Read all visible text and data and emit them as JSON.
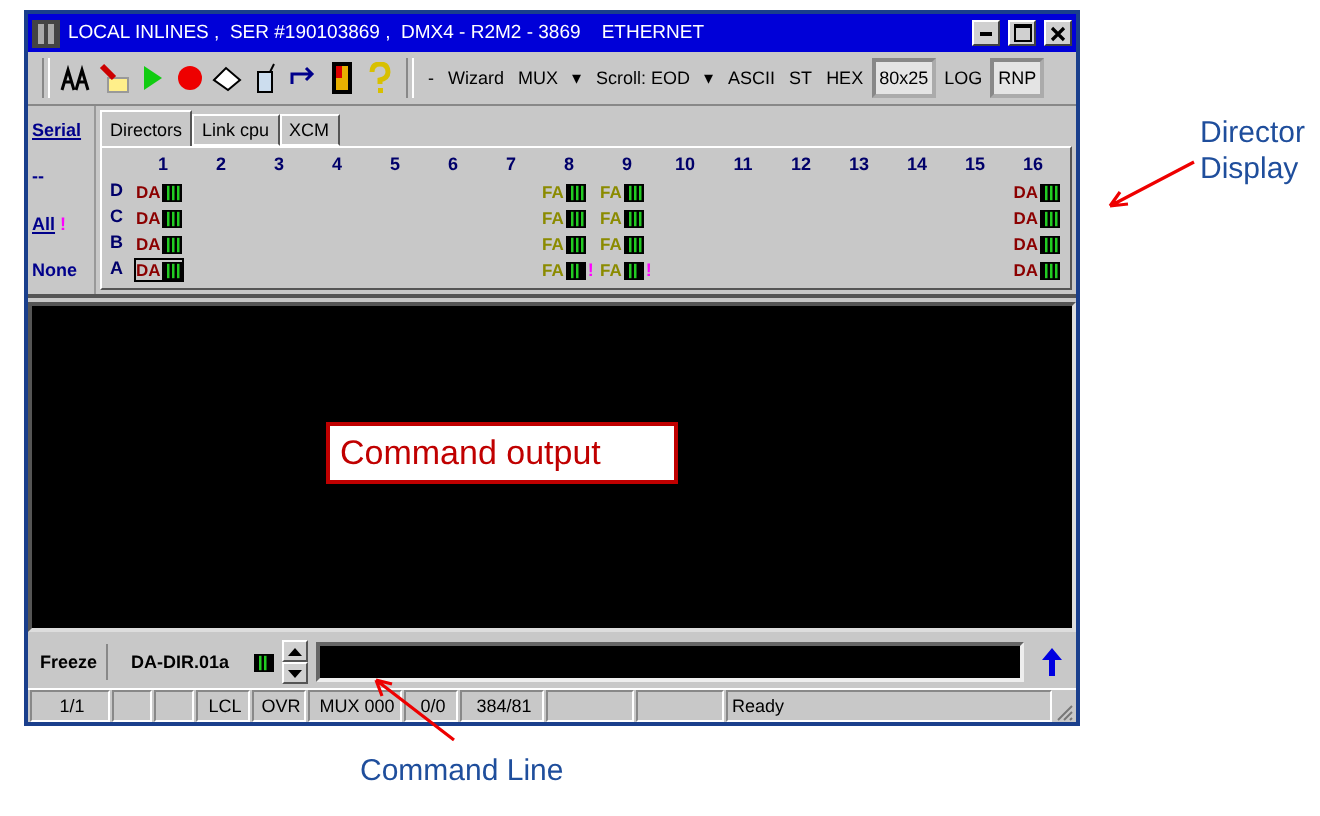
{
  "window": {
    "title": "LOCAL INLINES ,  SER #190103869 ,  DMX4 - R2M2 - 3869    ETHERNET"
  },
  "toolbar": {
    "items": [
      {
        "label": "-",
        "kind": "text",
        "pressed": false
      },
      {
        "label": "Wizard",
        "kind": "text",
        "pressed": false
      },
      {
        "label": "MUX",
        "kind": "text",
        "pressed": false
      },
      {
        "label": "▾",
        "kind": "text",
        "pressed": false
      },
      {
        "label": "Scroll: EOD",
        "kind": "text",
        "pressed": false
      },
      {
        "label": "▾",
        "kind": "text",
        "pressed": false
      },
      {
        "label": "ASCII",
        "kind": "text",
        "pressed": false
      },
      {
        "label": "ST",
        "kind": "text",
        "pressed": false
      },
      {
        "label": "HEX",
        "kind": "text",
        "pressed": false
      },
      {
        "label": "80x25",
        "kind": "text",
        "pressed": true
      },
      {
        "label": "LOG",
        "kind": "text",
        "pressed": false
      },
      {
        "label": "RNP",
        "kind": "text",
        "pressed": true
      }
    ]
  },
  "side_links": [
    {
      "label": "Serial",
      "kind": "link"
    },
    {
      "label": "--",
      "kind": "label"
    },
    {
      "label": "All",
      "kind": "link",
      "mark": "!"
    },
    {
      "label": "None",
      "kind": "label"
    }
  ],
  "tabs": [
    {
      "label": "Directors",
      "selected": true
    },
    {
      "label": "Link cpu",
      "selected": false
    },
    {
      "label": "XCM",
      "selected": false
    }
  ],
  "directors": {
    "columns": [
      "1",
      "2",
      "3",
      "4",
      "5",
      "6",
      "7",
      "8",
      "9",
      "10",
      "11",
      "12",
      "13",
      "14",
      "15",
      "16"
    ],
    "rows": [
      {
        "label": "D",
        "cells": [
          {
            "kind": "da",
            "text": "DA",
            "selected": false
          },
          {
            "kind": "empty"
          },
          {
            "kind": "empty"
          },
          {
            "kind": "empty"
          },
          {
            "kind": "empty"
          },
          {
            "kind": "empty"
          },
          {
            "kind": "empty"
          },
          {
            "kind": "fa",
            "text": "FA",
            "selected": false
          },
          {
            "kind": "fa",
            "text": "FA",
            "selected": false
          },
          {
            "kind": "empty"
          },
          {
            "kind": "empty"
          },
          {
            "kind": "empty"
          },
          {
            "kind": "empty"
          },
          {
            "kind": "empty"
          },
          {
            "kind": "empty"
          },
          {
            "kind": "da",
            "text": "DA",
            "selected": false
          }
        ]
      },
      {
        "label": "C",
        "cells": [
          {
            "kind": "da",
            "text": "DA",
            "selected": false
          },
          {
            "kind": "empty"
          },
          {
            "kind": "empty"
          },
          {
            "kind": "empty"
          },
          {
            "kind": "empty"
          },
          {
            "kind": "empty"
          },
          {
            "kind": "empty"
          },
          {
            "kind": "fa",
            "text": "FA",
            "selected": false
          },
          {
            "kind": "fa",
            "text": "FA",
            "selected": false
          },
          {
            "kind": "empty"
          },
          {
            "kind": "empty"
          },
          {
            "kind": "empty"
          },
          {
            "kind": "empty"
          },
          {
            "kind": "empty"
          },
          {
            "kind": "empty"
          },
          {
            "kind": "da",
            "text": "DA",
            "selected": false
          }
        ]
      },
      {
        "label": "B",
        "cells": [
          {
            "kind": "da",
            "text": "DA",
            "selected": false
          },
          {
            "kind": "empty"
          },
          {
            "kind": "empty"
          },
          {
            "kind": "empty"
          },
          {
            "kind": "empty"
          },
          {
            "kind": "empty"
          },
          {
            "kind": "empty"
          },
          {
            "kind": "fa",
            "text": "FA",
            "selected": false
          },
          {
            "kind": "fa",
            "text": "FA",
            "selected": false
          },
          {
            "kind": "empty"
          },
          {
            "kind": "empty"
          },
          {
            "kind": "empty"
          },
          {
            "kind": "empty"
          },
          {
            "kind": "empty"
          },
          {
            "kind": "empty"
          },
          {
            "kind": "da",
            "text": "DA",
            "selected": false
          }
        ]
      },
      {
        "label": "A",
        "cells": [
          {
            "kind": "da",
            "text": "DA",
            "selected": true
          },
          {
            "kind": "empty"
          },
          {
            "kind": "empty"
          },
          {
            "kind": "empty"
          },
          {
            "kind": "empty"
          },
          {
            "kind": "empty"
          },
          {
            "kind": "empty"
          },
          {
            "kind": "fa",
            "text": "FA",
            "selected": false,
            "alert": "!"
          },
          {
            "kind": "fa",
            "text": "FA",
            "selected": false,
            "alert": "!"
          },
          {
            "kind": "empty"
          },
          {
            "kind": "empty"
          },
          {
            "kind": "empty"
          },
          {
            "kind": "empty"
          },
          {
            "kind": "empty"
          },
          {
            "kind": "empty"
          },
          {
            "kind": "da",
            "text": "DA",
            "selected": false
          }
        ]
      }
    ]
  },
  "command_bar": {
    "freeze": "Freeze",
    "target": "DA-DIR.01a"
  },
  "status_bar": [
    {
      "text": "1/1"
    },
    {
      "kind": "blank"
    },
    {
      "kind": "blank"
    },
    {
      "text": "LCL"
    },
    {
      "text": "OVR"
    },
    {
      "text": "MUX 000"
    },
    {
      "text": "0/0"
    },
    {
      "text": "384/81"
    },
    {
      "kind": "blank"
    },
    {
      "kind": "blank"
    },
    {
      "text": "Ready"
    }
  ],
  "annotations": [
    {
      "kind": "director",
      "text": "Director Display"
    },
    {
      "kind": "output",
      "text": "Command output"
    },
    {
      "kind": "command",
      "text": "Command Line"
    }
  ]
}
